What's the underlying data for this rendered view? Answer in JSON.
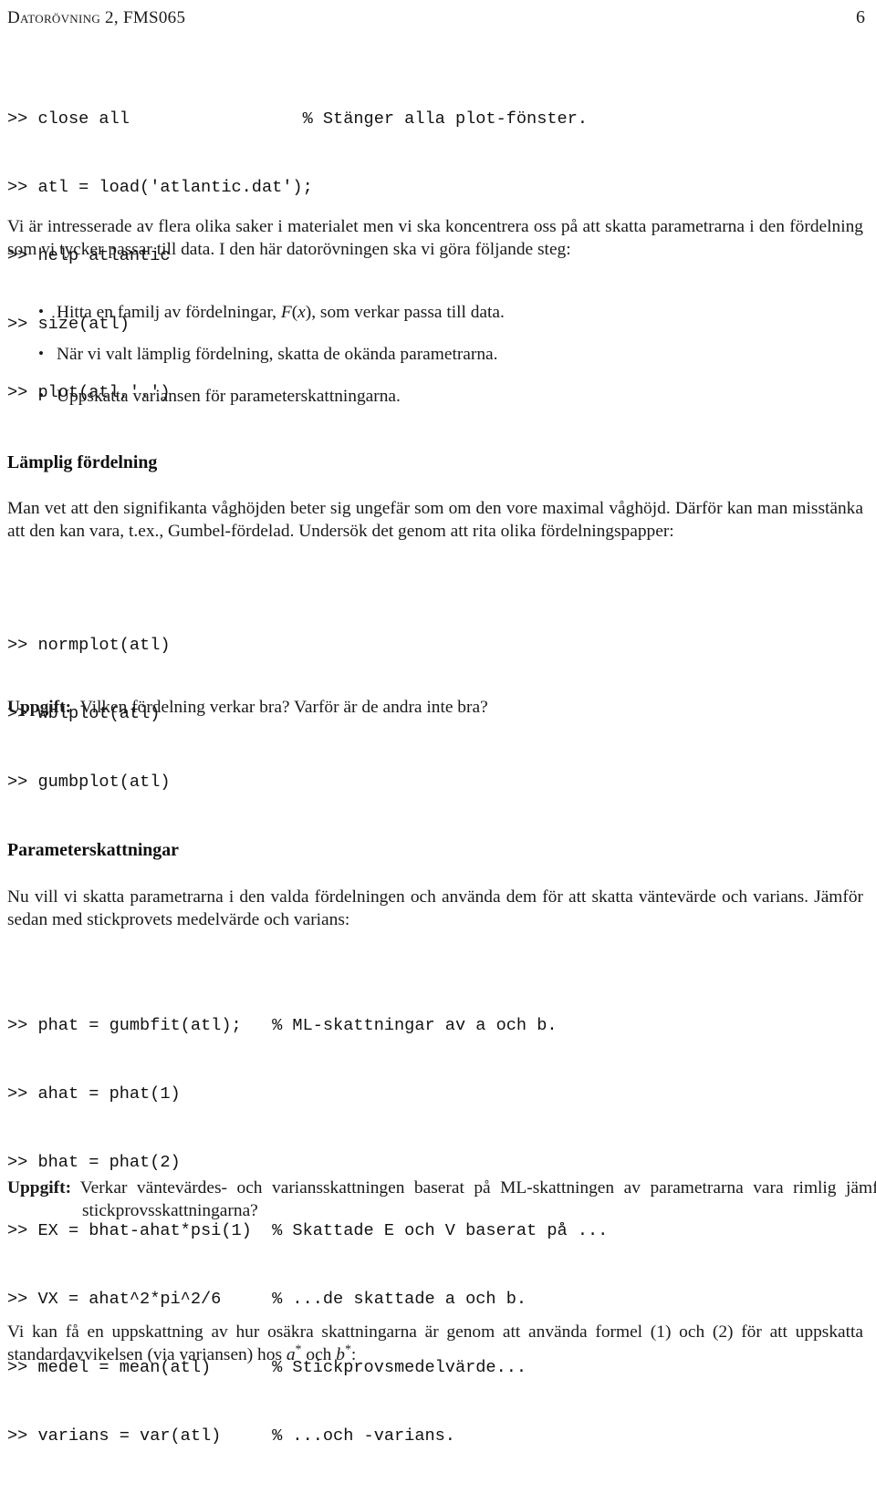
{
  "header": {
    "title": "Datorövning 2, FMS065",
    "page_number": "6"
  },
  "code_block_1": {
    "lines": [
      ">> close all                 % Stänger alla plot-fönster.",
      ">> atl = load('atlantic.dat');",
      ">> help atlantic",
      ">> size(atl)",
      ">> plot(atl,'.')"
    ]
  },
  "intro_paragraph": "Vi är intresserade av flera olika saker i materialet men vi ska koncentrera oss på att skatta parametrarna i den fördelning som vi tycker passar till data. I den här datorövningen ska vi göra följande steg:",
  "bullets": [
    {
      "pre": "Hitta en familj av fördelningar, ",
      "math_f": "F",
      "math_x": "x",
      "post": "), som verkar passa till data.",
      "full": "Hitta en familj av fördelningar, F(x), som verkar passa till data."
    },
    {
      "full": "När vi valt lämplig fördelning, skatta de okända parametrarna."
    },
    {
      "full": "Uppskatta variansen för parameterskattningarna."
    }
  ],
  "section_lamplig": {
    "heading": "Lämplig fördelning",
    "paragraph": "Man vet att den signifikanta våghöjden beter sig ungefär som om den vore maximal våghöjd. Därför kan man misstänka att den kan vara, t.ex., Gumbel-fördelad. Undersök det genom att rita olika fördelningspapper:"
  },
  "code_block_2": {
    "lines": [
      ">> normplot(atl)",
      ">> wblplot(atl)",
      ">> gumbplot(atl)"
    ]
  },
  "uppgift_1": {
    "label": "Uppgift:",
    "text": "Vilken fördelning verkar bra? Varför är de andra inte bra?"
  },
  "section_parameter": {
    "heading": "Parameterskattningar",
    "paragraph": "Nu vill vi skatta parametrarna i den valda fördelningen och använda dem för att skatta väntevärde och varians. Jämför sedan med stickprovets medelvärde och varians:"
  },
  "code_block_3": {
    "lines": [
      ">> phat = gumbfit(atl);   % ML-skattningar av a och b.",
      ">> ahat = phat(1)",
      ">> bhat = phat(2)",
      ">> EX = bhat-ahat*psi(1)  % Skattade E och V baserat på ...",
      ">> VX = ahat^2*pi^2/6     % ...de skattade a och b.",
      ">> medel = mean(atl)      % Stickprovsmedelvärde...",
      ">> varians = var(atl)     % ...och -varians."
    ]
  },
  "uppgift_2": {
    "label": "Uppgift:",
    "text": "Verkar väntevärdes- och variansskattningen baserat på ML-skattningen av parametrarna vara rimlig jämfört med stickprovsskattningarna?"
  },
  "closing_paragraph": {
    "part1": "Vi kan få en uppskattning av hur osäkra skattningarna är genom att använda formel (1) och (2) för att uppskatta standardavvikelsen (via variansen) hos ",
    "math_a": "a",
    "star1": "*",
    "mid": " och ",
    "math_b": "b",
    "star2": "*",
    "part2": ":"
  }
}
